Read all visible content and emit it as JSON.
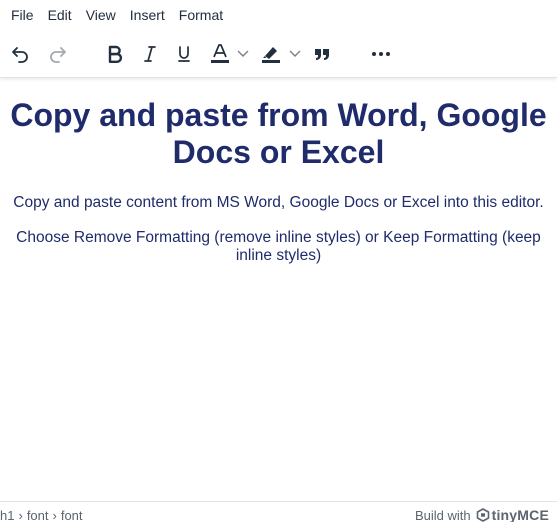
{
  "menubar": {
    "items": [
      {
        "label": "File"
      },
      {
        "label": "Edit"
      },
      {
        "label": "View"
      },
      {
        "label": "Insert"
      },
      {
        "label": "Format"
      }
    ]
  },
  "toolbar": {
    "buttons": [
      {
        "icon": "undo-icon"
      },
      {
        "icon": "redo-icon",
        "disabled": true
      },
      {
        "icon": "bold-icon"
      },
      {
        "icon": "italic-icon"
      },
      {
        "icon": "underline-icon"
      },
      {
        "icon": "text-color-icon",
        "swatch": "#222f3e"
      },
      {
        "icon": "highlight-color-icon",
        "swatch": "#222f3e"
      },
      {
        "icon": "blockquote-icon"
      },
      {
        "icon": "more-icon"
      }
    ]
  },
  "content": {
    "heading": "Copy and paste from Word, Google Docs or Excel",
    "paragraphs": [
      "Copy and paste content from MS Word, Google Docs or Excel into this editor.",
      "Choose Remove Formatting (remove inline styles) or Keep Formatting (keep inline styles)"
    ],
    "text_color": "#1f2b6b"
  },
  "statusbar": {
    "path": [
      "h1",
      "font",
      "font"
    ],
    "separator": "›",
    "branding_prefix": "Build with",
    "branding_name": "tinyMCE"
  }
}
